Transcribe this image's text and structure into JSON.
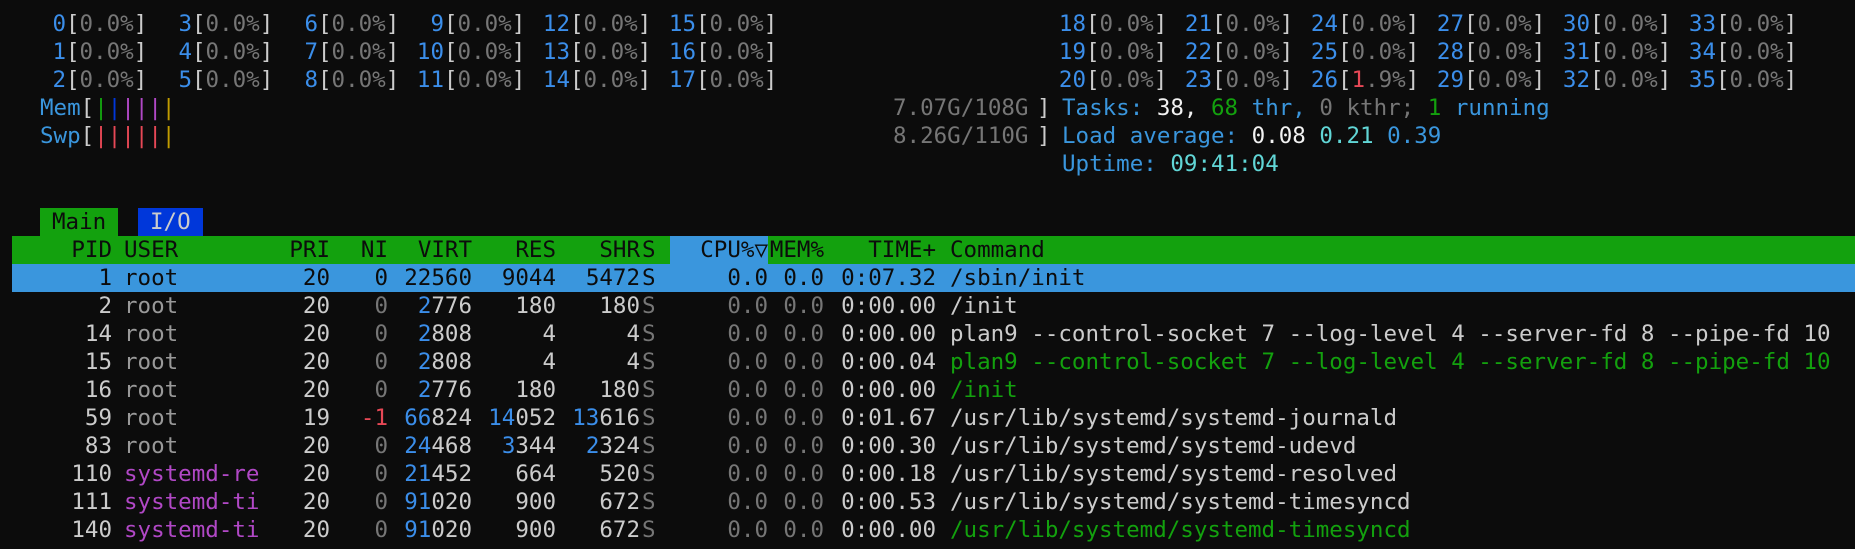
{
  "cpus": [
    {
      "id": "0",
      "val": "0.0%"
    },
    {
      "id": "1",
      "val": "0.0%"
    },
    {
      "id": "2",
      "val": "0.0%"
    },
    {
      "id": "3",
      "val": "0.0%"
    },
    {
      "id": "4",
      "val": "0.0%"
    },
    {
      "id": "5",
      "val": "0.0%"
    },
    {
      "id": "6",
      "val": "0.0%"
    },
    {
      "id": "7",
      "val": "0.0%"
    },
    {
      "id": "8",
      "val": "0.0%"
    },
    {
      "id": "9",
      "val": "0.0%"
    },
    {
      "id": "10",
      "val": "0.0%"
    },
    {
      "id": "11",
      "val": "0.0%"
    },
    {
      "id": "12",
      "val": "0.0%"
    },
    {
      "id": "13",
      "val": "0.0%"
    },
    {
      "id": "14",
      "val": "0.0%"
    },
    {
      "id": "15",
      "val": "0.0%"
    },
    {
      "id": "16",
      "val": "0.0%"
    },
    {
      "id": "17",
      "val": "0.0%"
    },
    {
      "id": "18",
      "val": "0.0%"
    },
    {
      "id": "19",
      "val": "0.0%"
    },
    {
      "id": "20",
      "val": "0.0%"
    },
    {
      "id": "21",
      "val": "0.0%"
    },
    {
      "id": "22",
      "val": "0.0%"
    },
    {
      "id": "23",
      "val": "0.0%"
    },
    {
      "id": "24",
      "val": "0.0%"
    },
    {
      "id": "25",
      "val": "0.0%"
    },
    {
      "id": "26",
      "val": "1.9%"
    },
    {
      "id": "27",
      "val": "0.0%"
    },
    {
      "id": "28",
      "val": "0.0%"
    },
    {
      "id": "29",
      "val": "0.0%"
    },
    {
      "id": "30",
      "val": "0.0%"
    },
    {
      "id": "31",
      "val": "0.0%"
    },
    {
      "id": "32",
      "val": "0.0%"
    },
    {
      "id": "33",
      "val": "0.0%"
    },
    {
      "id": "34",
      "val": "0.0%"
    },
    {
      "id": "35",
      "val": "0.0%"
    }
  ],
  "mem": {
    "label": "Mem",
    "value": "7.07G/108G"
  },
  "swp": {
    "label": "Swp",
    "value": "8.26G/110G"
  },
  "tasks": {
    "label": "Tasks:",
    "count": "38,",
    "threads": "68",
    "thr_label": "thr,",
    "kthr": "0",
    "kthr_label": "kthr;",
    "running": "1",
    "running_label": "running"
  },
  "load": {
    "label": "Load average:",
    "l1": "0.08",
    "l5": "0.21",
    "l15": "0.39"
  },
  "uptime": {
    "label": "Uptime:",
    "value": "09:41:04"
  },
  "tabs": {
    "main": "Main",
    "io": "I/O"
  },
  "columns": {
    "pid": "PID",
    "user": "USER",
    "pri": "PRI",
    "ni": "NI",
    "virt": "VIRT",
    "res": "RES",
    "shr": "SHR",
    "s": "S",
    "cpu": "CPU%▽",
    "mem": "MEM%",
    "time": "TIME+",
    "cmd": "Command"
  },
  "processes": [
    {
      "pid": "1",
      "user": "root",
      "pri": "20",
      "ni": "0",
      "virt": "22560",
      "res": "9044",
      "shr": "5472",
      "s": "S",
      "cpu": "0.0",
      "mem": "0.0",
      "time": "0:07.32",
      "cmd": "/sbin/init"
    },
    {
      "pid": "2",
      "user": "root",
      "pri": "20",
      "ni": "0",
      "virt": "2776",
      "res": "180",
      "shr": "180",
      "s": "S",
      "cpu": "0.0",
      "mem": "0.0",
      "time": "0:00.00",
      "cmd": "/init"
    },
    {
      "pid": "14",
      "user": "root",
      "pri": "20",
      "ni": "0",
      "virt": "2808",
      "res": "4",
      "shr": "4",
      "s": "S",
      "cpu": "0.0",
      "mem": "0.0",
      "time": "0:00.00",
      "cmd": "plan9 --control-socket 7 --log-level 4 --server-fd 8 --pipe-fd 10"
    },
    {
      "pid": "15",
      "user": "root",
      "pri": "20",
      "ni": "0",
      "virt": "2808",
      "res": "4",
      "shr": "4",
      "s": "S",
      "cpu": "0.0",
      "mem": "0.0",
      "time": "0:00.04",
      "cmd": "plan9 --control-socket 7 --log-level 4 --server-fd 8 --pipe-fd 10"
    },
    {
      "pid": "16",
      "user": "root",
      "pri": "20",
      "ni": "0",
      "virt": "2776",
      "res": "180",
      "shr": "180",
      "s": "S",
      "cpu": "0.0",
      "mem": "0.0",
      "time": "0:00.00",
      "cmd": "/init"
    },
    {
      "pid": "59",
      "user": "root",
      "pri": "19",
      "ni": "-1",
      "virt": "66824",
      "res": "14052",
      "shr": "13616",
      "s": "S",
      "cpu": "0.0",
      "mem": "0.0",
      "time": "0:01.67",
      "cmd": "/usr/lib/systemd/systemd-journald"
    },
    {
      "pid": "83",
      "user": "root",
      "pri": "20",
      "ni": "0",
      "virt": "24468",
      "res": "3344",
      "shr": "2324",
      "s": "S",
      "cpu": "0.0",
      "mem": "0.0",
      "time": "0:00.30",
      "cmd": "/usr/lib/systemd/systemd-udevd"
    },
    {
      "pid": "110",
      "user": "systemd-re",
      "pri": "20",
      "ni": "0",
      "virt": "21452",
      "res": "664",
      "shr": "520",
      "s": "S",
      "cpu": "0.0",
      "mem": "0.0",
      "time": "0:00.18",
      "cmd": "/usr/lib/systemd/systemd-resolved"
    },
    {
      "pid": "111",
      "user": "systemd-ti",
      "pri": "20",
      "ni": "0",
      "virt": "91020",
      "res": "900",
      "shr": "672",
      "s": "S",
      "cpu": "0.0",
      "mem": "0.0",
      "time": "0:00.53",
      "cmd": "/usr/lib/systemd/systemd-timesyncd"
    },
    {
      "pid": "140",
      "user": "systemd-ti",
      "pri": "20",
      "ni": "0",
      "virt": "91020",
      "res": "900",
      "shr": "672",
      "s": "S",
      "cpu": "0.0",
      "mem": "0.0",
      "time": "0:00.00",
      "cmd": "/usr/lib/systemd/systemd-timesyncd"
    }
  ]
}
